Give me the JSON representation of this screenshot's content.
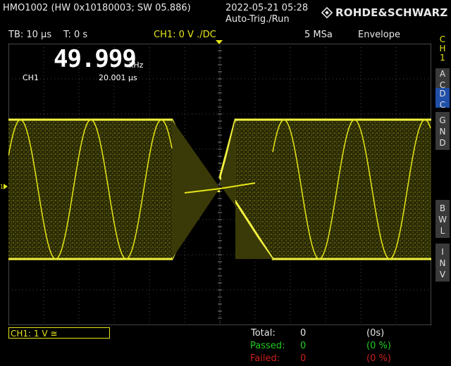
{
  "header": {
    "device": "HMO1002 (HW 0x10180003; SW 05.886)",
    "datetime": "2022-05-21 05:28",
    "trigger_status": "Auto-Trig./Run",
    "brand": "ROHDE&SCHWARZ"
  },
  "infobar": {
    "timebase": "TB: 10 µs",
    "trigger_time": "T: 0 s",
    "trigger_source": "CH1: 0 V ./DC",
    "sample_rate": "5 MSa",
    "mode": "Envelope"
  },
  "sidebar": {
    "channel": [
      "C",
      "H",
      "1"
    ],
    "buttons": [
      {
        "label": [
          "A",
          "C"
        ],
        "active": false
      },
      {
        "label": [
          "D",
          "C"
        ],
        "active": true
      },
      {
        "label": [
          "G",
          "N",
          "D"
        ],
        "active": false
      },
      {
        "label": [
          "B",
          "W",
          "L"
        ],
        "active": false
      },
      {
        "label": [
          "I",
          "N",
          "V"
        ],
        "active": false
      }
    ]
  },
  "measure": {
    "frequency": "49.999",
    "frequency_unit": "kHz",
    "channel": "CH1",
    "period": "20.001 µs"
  },
  "footer": {
    "channel_scale": "CH1: 1 V ≅",
    "total_label": "Total:",
    "total_value": "0",
    "total_time": "(0s)",
    "passed_label": "Passed:",
    "passed_value": "0",
    "passed_pct": "(0 %)",
    "failed_label": "Failed:",
    "failed_value": "0",
    "failed_pct": "(0 %)"
  },
  "colors": {
    "trace": "#e6e619",
    "passed": "#22cc22",
    "failed": "#cc2020",
    "active_button": "#1f4fa8"
  }
}
